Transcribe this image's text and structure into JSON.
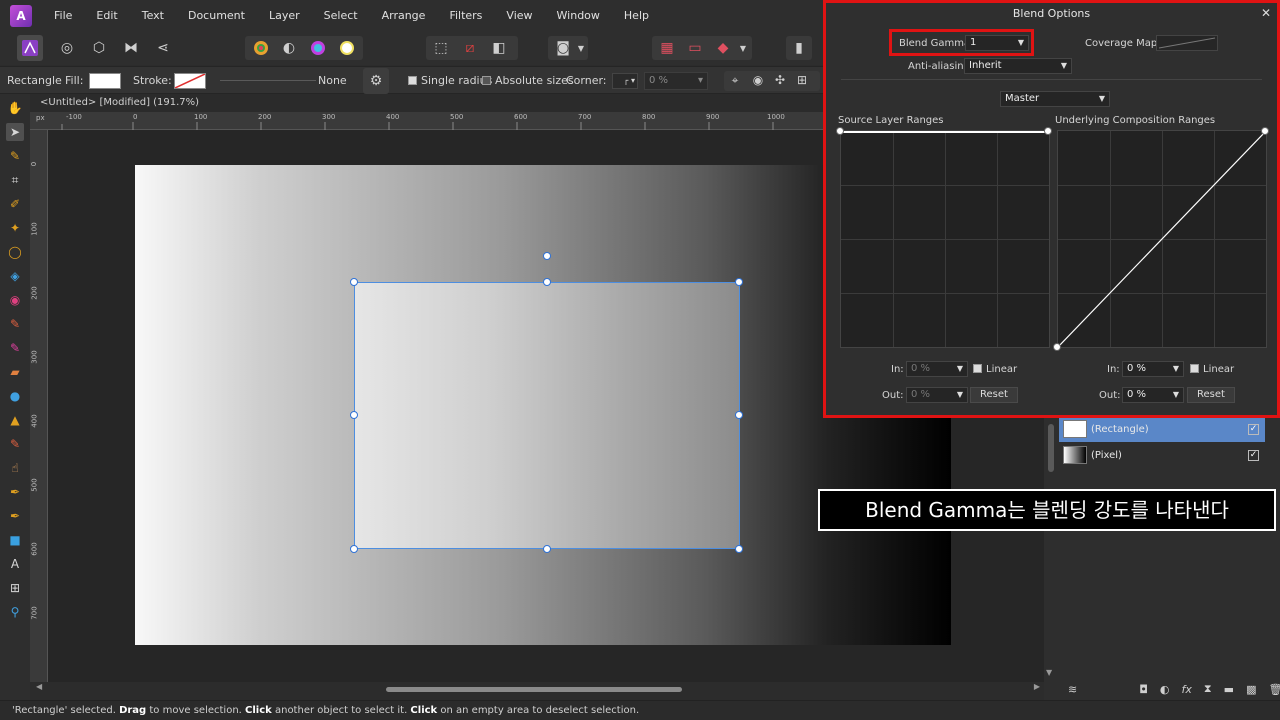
{
  "menu": {
    "items": [
      "File",
      "Edit",
      "Text",
      "Document",
      "Layer",
      "Select",
      "Arrange",
      "Filters",
      "View",
      "Window",
      "Help"
    ]
  },
  "context_bar": {
    "shape": "Rectangle",
    "fill_label": "Fill:",
    "stroke_label": "Stroke:",
    "stroke_none": "None",
    "single_radius": "Single radius",
    "absolute_sizes": "Absolute sizes",
    "corner_label": "Corner:",
    "corner_value": "0 %"
  },
  "document": {
    "tab_title": "<Untitled> [Modified] (191.7%)"
  },
  "ruler": {
    "unit": "px",
    "h_ticks": [
      "-100",
      "0",
      "100",
      "200",
      "300",
      "400",
      "500",
      "600",
      "700",
      "800",
      "900",
      "1000"
    ],
    "v_ticks": [
      "0",
      "100",
      "200",
      "300",
      "400",
      "500",
      "600",
      "700"
    ]
  },
  "blend_options": {
    "title": "Blend Options",
    "blend_gamma_label": "Blend Gamma:",
    "blend_gamma_value": "1",
    "coverage_map_label": "Coverage Map:",
    "anti_aliasing_label": "Anti-aliasing:",
    "anti_aliasing_value": "Inherit",
    "channel_value": "Master",
    "source_title": "Source Layer Ranges",
    "underlying_title": "Underlying Composition Ranges",
    "source_in_label": "In:",
    "source_in_value": "0 %",
    "source_out_label": "Out:",
    "source_out_value": "0 %",
    "source_linear": "Linear",
    "source_reset": "Reset",
    "under_in_label": "In:",
    "under_in_value": "0 %",
    "under_out_label": "Out:",
    "under_out_value": "0 %",
    "under_linear": "Linear",
    "under_reset": "Reset"
  },
  "layers": [
    {
      "name": "(Rectangle)",
      "selected": true
    },
    {
      "name": "(Pixel)",
      "selected": false
    }
  ],
  "annotation": {
    "text": "Blend Gamma는 블렌딩 강도를 나타낸다"
  },
  "status": {
    "p1": "'Rectangle' selected. ",
    "drag": "Drag",
    "p2": " to move selection. ",
    "click1": "Click",
    "p3": " another object to select it. ",
    "click2": "Click",
    "p4": " on an empty area to deselect selection."
  },
  "colors": {
    "highlight_red": "#e01313",
    "selection_blue": "#2f72d6",
    "layer_selected": "#5a87c8"
  }
}
